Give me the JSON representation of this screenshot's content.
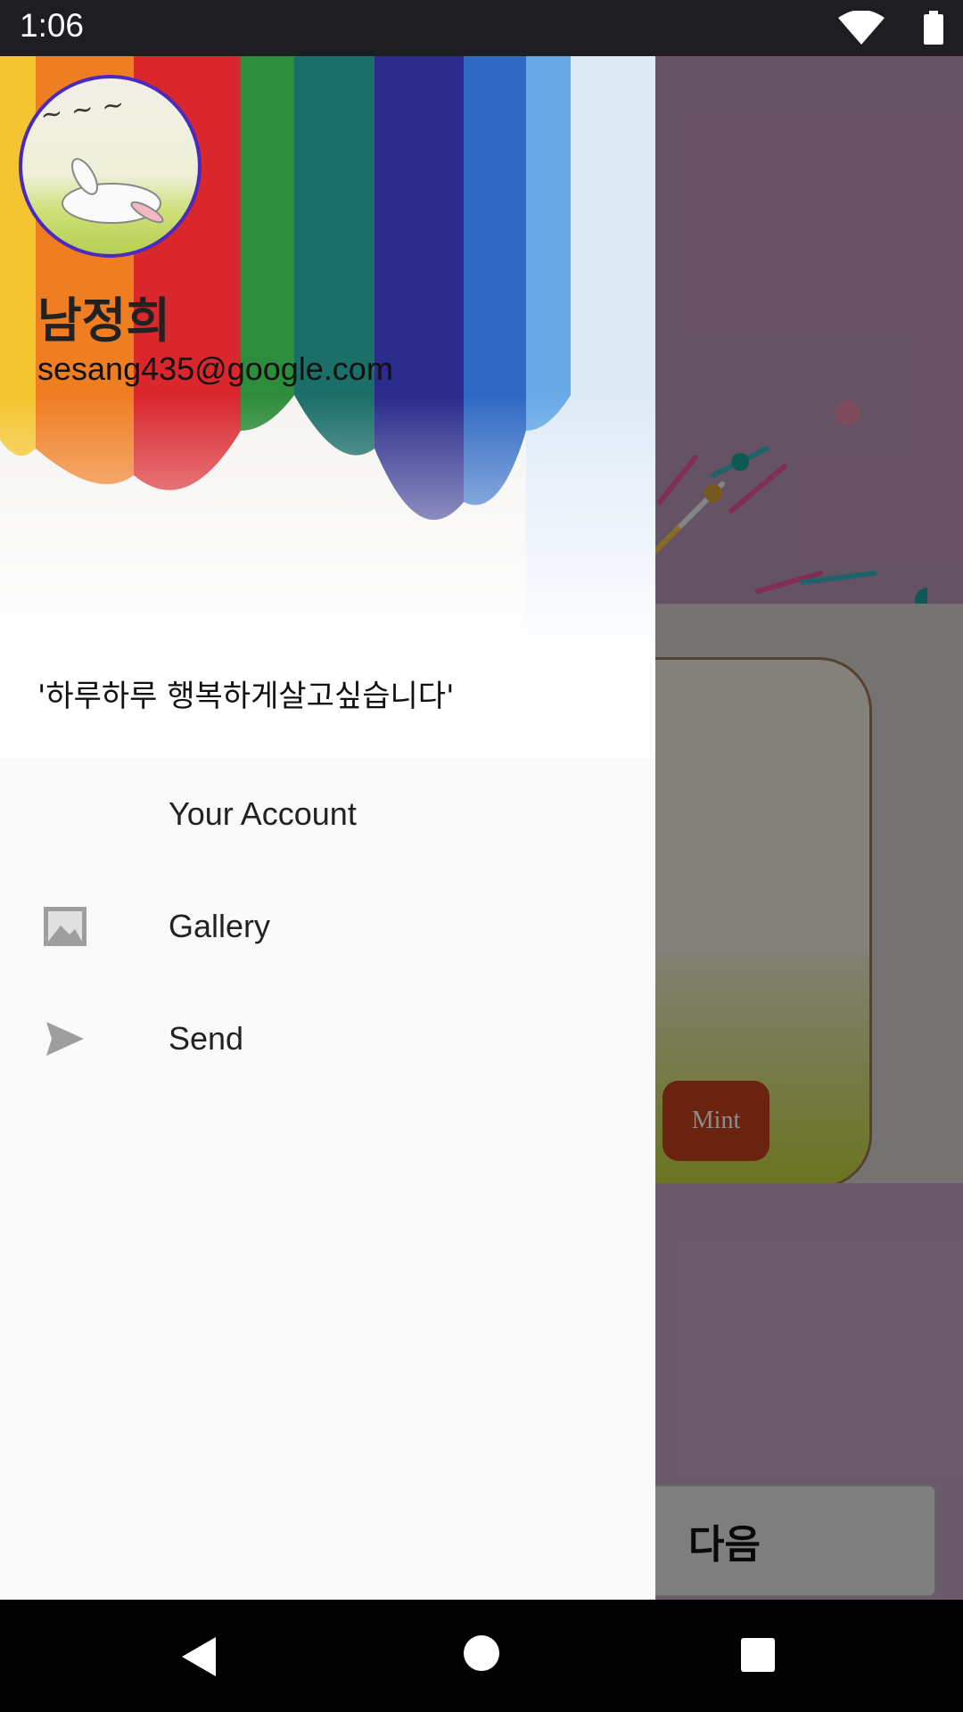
{
  "status_bar": {
    "time": "1:06",
    "icons": [
      "wifi-icon",
      "battery-icon"
    ]
  },
  "drawer": {
    "header": {
      "avatar_icon": "avatar-illustration",
      "name": "남정희",
      "email": "sesang435@google.com",
      "motto": "'하루하루 행복하게살고싶습니다'"
    },
    "menu": [
      {
        "label": "Your Account",
        "icon": ""
      },
      {
        "label": "Gallery",
        "icon": "image-icon"
      },
      {
        "label": "Send",
        "icon": "send-icon"
      }
    ]
  },
  "background_app": {
    "next_button_label": "다음",
    "card_stamp_text": "Mint"
  },
  "nav_bar": {
    "buttons": [
      "back-icon",
      "home-icon",
      "recents-icon"
    ]
  },
  "colors": {
    "drawer_bg": "#fafafa",
    "scrim": "rgba(0,0,0,0.45)",
    "avatar_border": "#4a2bbf"
  }
}
